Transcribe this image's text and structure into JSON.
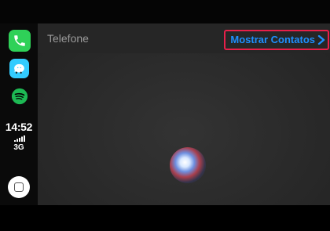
{
  "dock": {
    "apps": [
      {
        "name": "phone",
        "icon": "phone-icon",
        "color": "#2fd158"
      },
      {
        "name": "waze",
        "icon": "waze-icon",
        "color": "#33ccff"
      },
      {
        "name": "spotify",
        "icon": "spotify-icon",
        "color": "#1db954"
      }
    ],
    "time": "14:52",
    "network": "3G"
  },
  "nav": {
    "title": "Telefone",
    "action_label": "Mostrar Contatos"
  },
  "colors": {
    "accent": "#1e8fff",
    "highlight": "#e8204a"
  }
}
